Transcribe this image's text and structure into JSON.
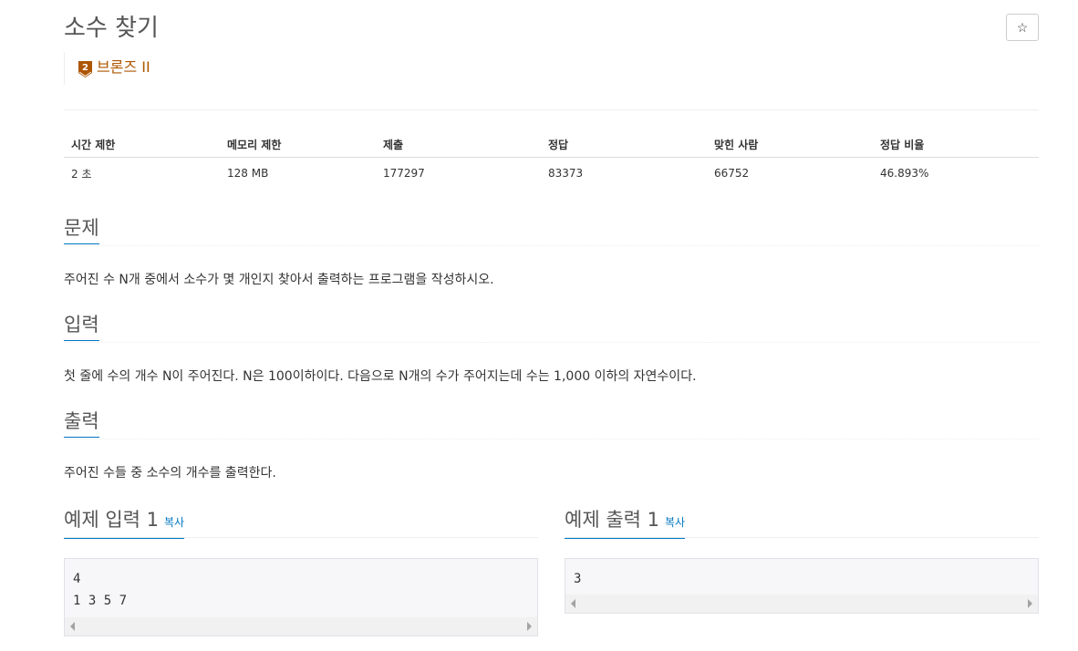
{
  "problem": {
    "title": "소수 찾기",
    "star_label": "☆",
    "tier": {
      "badge_number": "2",
      "label": "브론즈 II",
      "color": "#ad5600"
    }
  },
  "stats": {
    "headers": [
      "시간 제한",
      "메모리 제한",
      "제출",
      "정답",
      "맞힌 사람",
      "정답 비율"
    ],
    "values": [
      "2 초",
      "128 MB",
      "177297",
      "83373",
      "66752",
      "46.893%"
    ]
  },
  "sections": {
    "description": {
      "title": "문제",
      "text": "주어진 수 N개 중에서 소수가 몇 개인지 찾아서 출력하는 프로그램을 작성하시오."
    },
    "input": {
      "title": "입력",
      "text": "첫 줄에 수의 개수 N이 주어진다. N은 100이하이다. 다음으로 N개의 수가 주어지는데 수는 1,000 이하의 자연수이다."
    },
    "output": {
      "title": "출력",
      "text": "주어진 수들 중 소수의 개수를 출력한다."
    }
  },
  "samples": {
    "input": {
      "title": "예제 입력 1",
      "copy_label": "복사",
      "content": "4\n1 3 5 7"
    },
    "output": {
      "title": "예제 출력 1",
      "copy_label": "복사",
      "content": "3"
    }
  },
  "colors": {
    "accent": "#0076c0",
    "tier": "#ad5600"
  }
}
